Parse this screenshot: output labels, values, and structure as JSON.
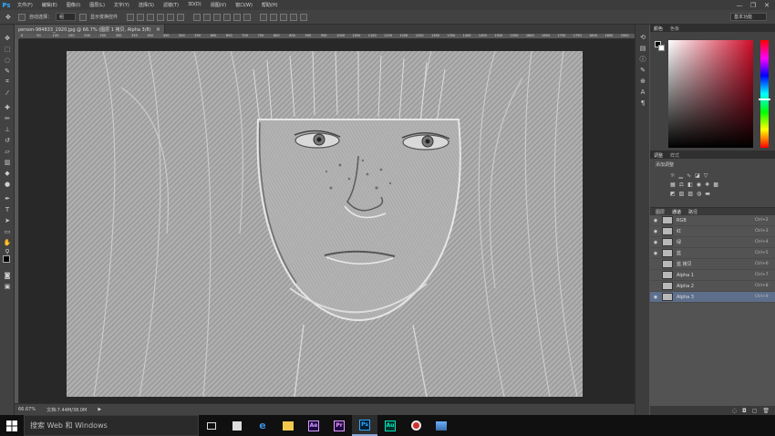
{
  "app": {
    "logo": "Ps"
  },
  "menu": [
    "文件(F)",
    "编辑(E)",
    "图像(I)",
    "图层(L)",
    "文字(Y)",
    "选择(S)",
    "滤镜(T)",
    "3D(D)",
    "视图(V)",
    "窗口(W)",
    "帮助(H)"
  ],
  "window_controls": {
    "minimize": "—",
    "restore": "❐",
    "close": "✕"
  },
  "options": {
    "auto_select_label": "自动选择：",
    "auto_select_value": "组",
    "show_transform_label": "显示变换控件",
    "workspace": "基本功能"
  },
  "document": {
    "tab_title": "person-984833_1920.jpg @ 66.7% (图层 1 拷贝, Alpha 3/8)",
    "tab_close": "×",
    "zoom": "66.67%",
    "doc_info": "文档:7.44M/38.0M"
  },
  "ruler_ticks": [
    "0",
    "50",
    "100",
    "150",
    "200",
    "250",
    "300",
    "350",
    "400",
    "450",
    "500",
    "550",
    "600",
    "650",
    "700",
    "750",
    "800",
    "850",
    "900",
    "950",
    "1000",
    "1050",
    "1100",
    "1150",
    "1200",
    "1250",
    "1300",
    "1350",
    "1400",
    "1450",
    "1500",
    "1550",
    "1600",
    "1650",
    "1700",
    "1750",
    "1800",
    "1850",
    "1900"
  ],
  "right_panels": {
    "color_tab": "颜色",
    "swatches_tab": "色板",
    "adjustments_tab": "调整",
    "styles_tab": "样式",
    "add_adjustment_label": "添加调整",
    "layers_tab": "图层",
    "channels_tab": "通道",
    "paths_tab": "路径"
  },
  "channels": [
    {
      "name": "RGB",
      "shortcut": "Ctrl+2",
      "visible": true,
      "selected": false
    },
    {
      "name": "红",
      "shortcut": "Ctrl+3",
      "visible": true,
      "selected": false
    },
    {
      "name": "绿",
      "shortcut": "Ctrl+4",
      "visible": true,
      "selected": false
    },
    {
      "name": "蓝",
      "shortcut": "Ctrl+5",
      "visible": true,
      "selected": false
    },
    {
      "name": "蓝 拷贝",
      "shortcut": "Ctrl+6",
      "visible": false,
      "selected": false
    },
    {
      "name": "Alpha 1",
      "shortcut": "Ctrl+7",
      "visible": false,
      "selected": false
    },
    {
      "name": "Alpha 2",
      "shortcut": "Ctrl+8",
      "visible": false,
      "selected": false
    },
    {
      "name": "Alpha 3",
      "shortcut": "Ctrl+9",
      "visible": true,
      "selected": true
    }
  ],
  "taskbar": {
    "search_placeholder": "搜索 Web 和 Windows"
  },
  "colors": {
    "accent": "#31a8ff",
    "selected_row": "#5e6f8c",
    "picker_hue": "#d00e2a"
  }
}
